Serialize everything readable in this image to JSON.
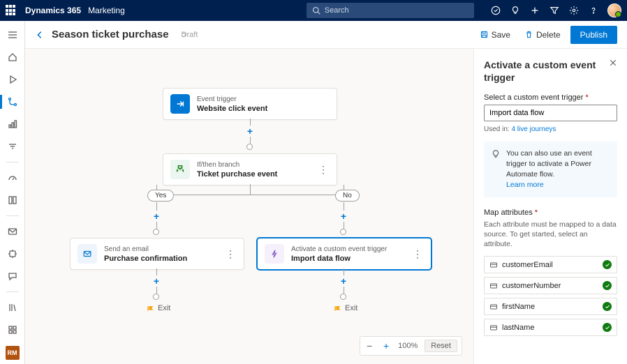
{
  "topbar": {
    "brand": "Dynamics 365",
    "area": "Marketing",
    "search_placeholder": "Search"
  },
  "cmd": {
    "title": "Season ticket purchase",
    "status": "Draft",
    "save": "Save",
    "delete": "Delete",
    "publish": "Publish"
  },
  "canvas": {
    "trigger": {
      "label": "Event trigger",
      "title": "Website click event"
    },
    "branch": {
      "label": "If/then branch",
      "title": "Ticket purchase event"
    },
    "yes": "Yes",
    "no": "No",
    "email": {
      "label": "Send an email",
      "title": "Purchase confirmation"
    },
    "custom": {
      "label": "Activate a custom event trigger",
      "title": "Import data flow"
    },
    "exit": "Exit",
    "zoom": {
      "pct": "100%",
      "reset": "Reset"
    }
  },
  "panel": {
    "title": "Activate a custom event trigger",
    "select_label": "Select a custom event trigger",
    "select_value": "Import data flow",
    "usedin_prefix": "Used in: ",
    "usedin_link": "4 live journeys",
    "tip": "You can also use an event trigger to activate a Power Automate flow.",
    "learn": "Learn more",
    "map_label": "Map attributes",
    "map_sub": "Each attribute must be mapped to a data source. To get started, select an attribute.",
    "attrs": [
      "customerEmail",
      "customerNumber",
      "firstName",
      "lastName"
    ]
  },
  "rail": {
    "rm": "RM"
  }
}
